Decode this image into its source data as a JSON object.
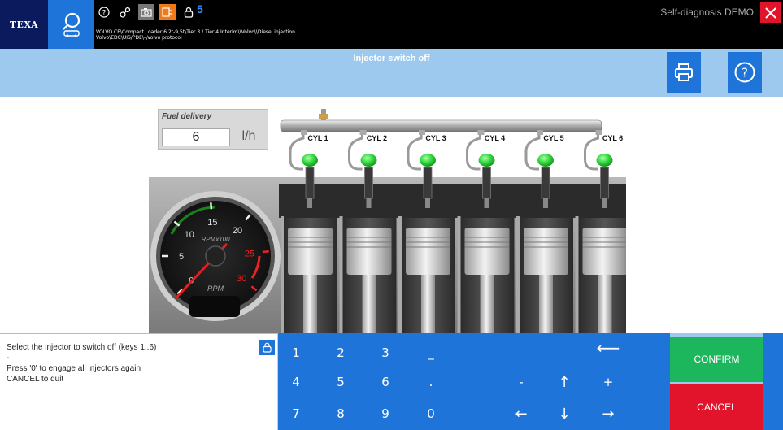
{
  "app": {
    "brand": "TEXA",
    "lock_count": "5",
    "path_line1": "VOLVO CE\\Compact Loader 6,2t-9,5t\\Tier 3 / Tier 4 Interim\\\\Volvo\\\\Diesel injection",
    "path_line2": "Volvo\\EDC\\UIS/PDE\\-\\Volvo protocol",
    "mode": "Self-diagnosis DEMO"
  },
  "header": {
    "title": "Injector switch off"
  },
  "fuel": {
    "label": "Fuel delivery",
    "value": "6",
    "unit": "l/h"
  },
  "cylinders": [
    "CYL 1",
    "CYL 2",
    "CYL 3",
    "CYL 4",
    "CYL 5",
    "CYL 6"
  ],
  "tachometer": {
    "ticks": [
      "0",
      "5",
      "10",
      "15",
      "20",
      "25",
      "30"
    ],
    "scale_label": "RPMx100",
    "unit_label": "RPM"
  },
  "message": {
    "line1": "Select the injector to switch off (keys 1..6)",
    "line2": "-",
    "line3": "Press '0' to engage all injectors again",
    "line4": "CANCEL to quit"
  },
  "keypad": {
    "k1": "1",
    "k2": "2",
    "k3": "3",
    "k_underscore": "_",
    "k_backspace": "⟵",
    "k4": "4",
    "k5": "5",
    "k6": "6",
    "k_dot": ".",
    "k_minus": "-",
    "k_up": "↑",
    "k_plus": "+",
    "k7": "7",
    "k8": "8",
    "k9": "9",
    "k0": "0",
    "k_left": "←",
    "k_down": "↓",
    "k_right": "→"
  },
  "actions": {
    "confirm": "CONFIRM",
    "cancel": "CANCEL"
  },
  "colors": {
    "brand_blue": "#1e74d8",
    "header_blue": "#9dc9ef",
    "confirm_green": "#1cb75d",
    "cancel_red": "#e2142b",
    "injector_green": "#33d93f"
  }
}
